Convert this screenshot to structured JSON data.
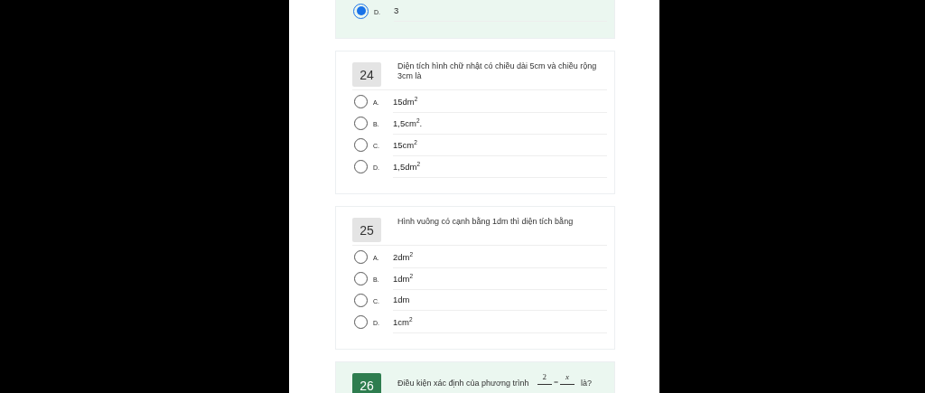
{
  "questions": [
    {
      "answered": true,
      "options": [
        {
          "letter": "D.",
          "text": "3",
          "selected": true
        }
      ]
    },
    {
      "number": "24",
      "answered": false,
      "text": "Diện tích hình chữ nhật có chiều dài 5cm và chiều rộng 3cm là",
      "options": [
        {
          "letter": "A.",
          "text": "15dm$^{2}$",
          "selected": false
        },
        {
          "letter": "B.",
          "text": "1,5cm$^{2}$.",
          "selected": false
        },
        {
          "letter": "C.",
          "text": "15cm$^{2}$",
          "selected": false
        },
        {
          "letter": "D.",
          "text": "1,5dm$^{2}$",
          "selected": false
        }
      ]
    },
    {
      "number": "25",
      "answered": false,
      "text": "Hình vuông có cạnh bằng 1dm thì diện tích bằng",
      "options": [
        {
          "letter": "A.",
          "text": "2dm$^{2}$",
          "selected": false
        },
        {
          "letter": "B.",
          "text": "1dm$^{2}$",
          "selected": false
        },
        {
          "letter": "C.",
          "text": "1dm",
          "selected": false
        },
        {
          "letter": "D.",
          "text": "1cm$^{2}$",
          "selected": false
        }
      ]
    },
    {
      "number": "26",
      "answered": true,
      "text": "Điều kiện xác định của phương trình",
      "equation": {
        "left_numerator": "2",
        "equals": "=",
        "right_numerator": "x"
      },
      "text_after": "là?"
    }
  ]
}
